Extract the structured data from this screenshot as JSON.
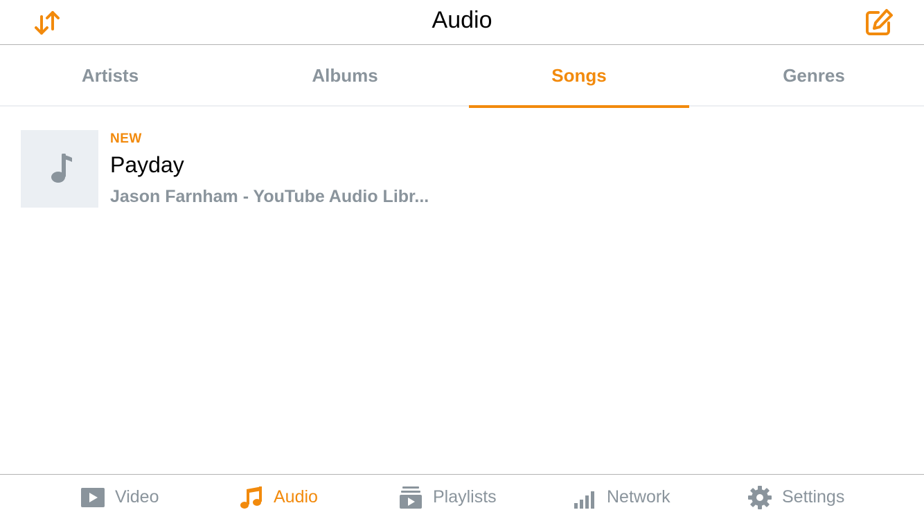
{
  "navbar": {
    "title": "Audio",
    "left_icon": "sort-icon",
    "right_icon": "edit-icon"
  },
  "tabs": [
    {
      "label": "Artists",
      "active": false
    },
    {
      "label": "Albums",
      "active": false
    },
    {
      "label": "Songs",
      "active": true
    },
    {
      "label": "Genres",
      "active": false
    }
  ],
  "songs": [
    {
      "badge": "NEW",
      "title": "Payday",
      "subtitle": "Jason Farnham - YouTube Audio Libr...",
      "thumbnail_icon": "music-note-icon"
    }
  ],
  "tabbar": [
    {
      "label": "Video",
      "icon": "video-icon",
      "active": false
    },
    {
      "label": "Audio",
      "icon": "music-note-icon",
      "active": true
    },
    {
      "label": "Playlists",
      "icon": "playlist-icon",
      "active": false
    },
    {
      "label": "Network",
      "icon": "network-signal-icon",
      "active": false
    },
    {
      "label": "Settings",
      "icon": "gear-icon",
      "active": false
    }
  ],
  "colors": {
    "accent": "#f28a0c",
    "inactive": "#8a949c",
    "thumbnail_bg": "#ebeff3"
  }
}
